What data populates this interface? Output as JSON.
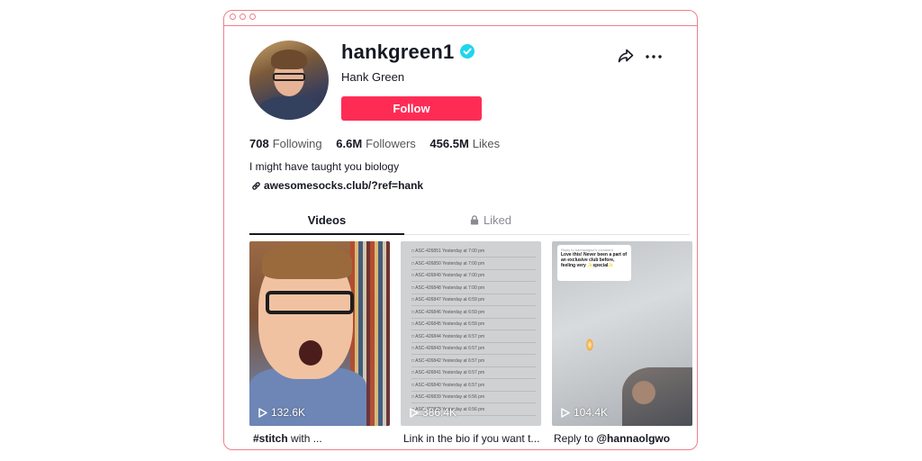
{
  "profile": {
    "username": "hankgreen1",
    "display_name": "Hank Green",
    "follow_label": "Follow",
    "bio": "I might have taught you biology",
    "link": "awesomesocks.club/?ref=hank"
  },
  "stats": [
    {
      "value": "708",
      "label": "Following"
    },
    {
      "value": "6.6M",
      "label": "Followers"
    },
    {
      "value": "456.5M",
      "label": "Likes"
    }
  ],
  "tabs": {
    "videos": "Videos",
    "liked": "Liked"
  },
  "videos": [
    {
      "views": "132.6K",
      "caption": "#stitch",
      "caption_rest": " with ..."
    },
    {
      "views": "386.4K",
      "caption": "Link in the bio if you want t..."
    },
    {
      "views": "104.4K",
      "caption_prefix": "Reply to ",
      "caption_mention": "@hannaolgwo"
    }
  ],
  "thumb3_card": {
    "header": "Reply to hannaolgwo's comment",
    "text": "Love this! Never been a part of an exclusive club before, feeling very ✨special✨"
  },
  "thumb2_rows": [
    {
      "id": "ASC-426851",
      "time": "Yesterday at 7:00 pm"
    },
    {
      "id": "ASC-426850",
      "time": "Yesterday at 7:00 pm"
    },
    {
      "id": "ASC-426849",
      "time": "Yesterday at 7:00 pm"
    },
    {
      "id": "ASC-426848",
      "time": "Yesterday at 7:00 pm"
    },
    {
      "id": "ASC-426847",
      "time": "Yesterday at 6:59 pm"
    },
    {
      "id": "ASC-426846",
      "time": "Yesterday at 6:59 pm"
    },
    {
      "id": "ASC-426845",
      "time": "Yesterday at 6:59 pm"
    },
    {
      "id": "ASC-426844",
      "time": "Yesterday at 6:57 pm"
    },
    {
      "id": "ASC-426843",
      "time": "Yesterday at 6:57 pm"
    },
    {
      "id": "ASC-426842",
      "time": "Yesterday at 6:57 pm"
    },
    {
      "id": "ASC-426841",
      "time": "Yesterday at 6:57 pm"
    },
    {
      "id": "ASC-426840",
      "time": "Yesterday at 6:57 pm"
    },
    {
      "id": "ASC-426839",
      "time": "Yesterday at 6:56 pm"
    },
    {
      "id": "ASC-426838",
      "time": "Yesterday at 6:56 pm"
    }
  ],
  "colors": {
    "accent": "#fe2c55",
    "verified": "#20d5ec",
    "frame": "#ee7f8b"
  }
}
